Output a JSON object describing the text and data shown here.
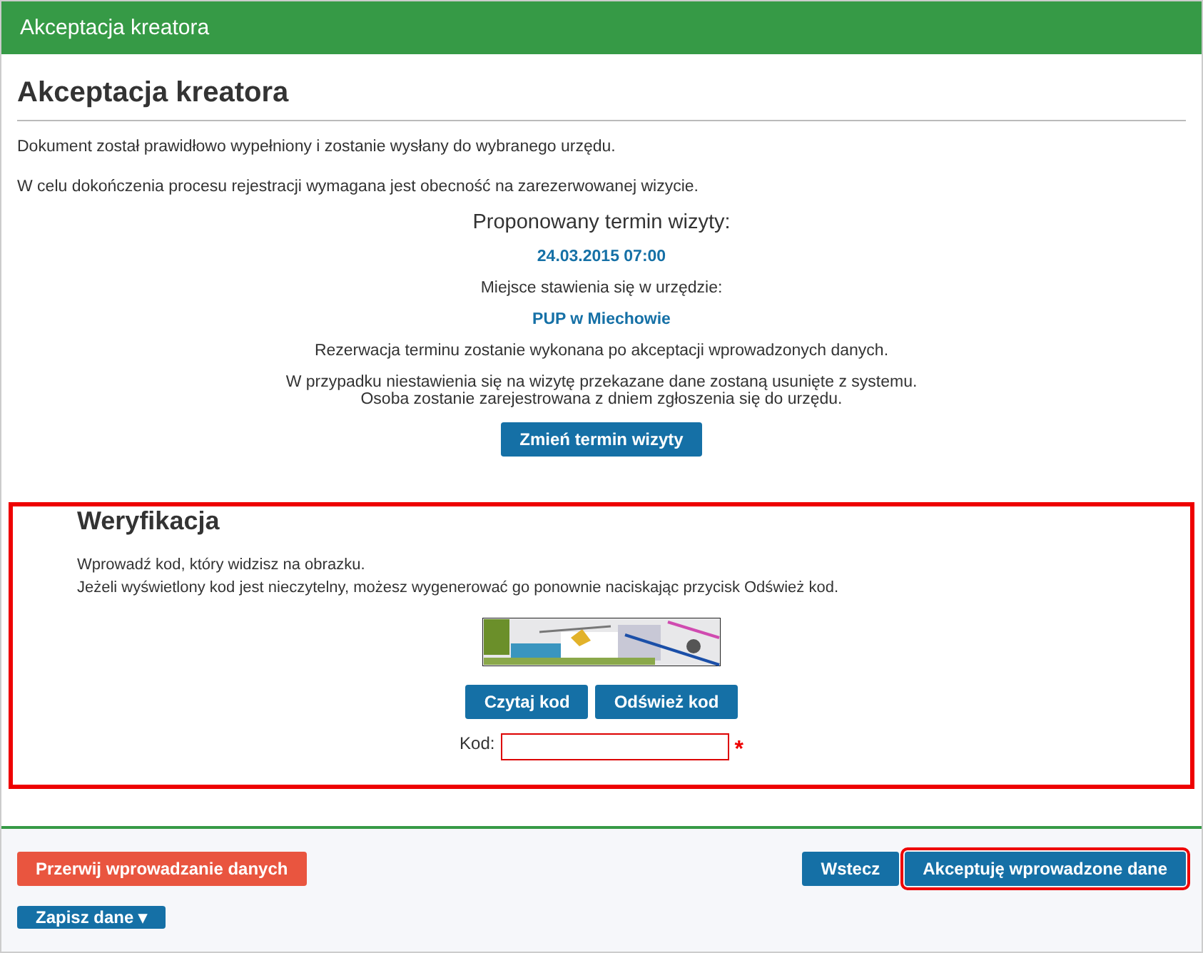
{
  "window": {
    "title": "Akceptacja kreatora"
  },
  "page": {
    "heading": "Akceptacja kreatora",
    "paragraphs": [
      "Dokument został prawidłowo wypełniony i zostanie wysłany do wybranego urzędu.",
      "W celu dokończenia procesu rejestracji wymagana jest obecność na zarezerwowanej wizycie."
    ]
  },
  "appointment": {
    "heading": "Proponowany termin wizyty:",
    "date": "24.03.2015 07:00",
    "place_label": "Miejsce stawienia się w urzędzie:",
    "place": "PUP w Miechowie",
    "note": "Rezerwacja terminu zostanie wykonana po akceptacji wprowadzonych danych.",
    "warning_lines": [
      "W przypadku niestawienia się na wizytę przekazane dane zostaną usunięte z systemu.",
      "Osoba zostanie zarejestrowana z dniem zgłoszenia się do urzędu."
    ],
    "button": "Zmień termin wizyty"
  },
  "verification": {
    "highlighted": true,
    "heading": "Weryfikacja",
    "instructions": [
      "Wprowadź kod, który widzisz na obrazku.",
      "Jeżeli wyświetlony kod jest nieczytelny, możesz wygenerować go ponownie naciskając przycisk Odśwież kod."
    ],
    "buttons": [
      "Czytaj kod",
      "Odśwież kod"
    ],
    "field_label": "Kod:",
    "required_mark": "*"
  },
  "footer": {
    "cancel": "Przerwij wprowadzanie danych",
    "back": "Wstecz",
    "accept": {
      "label": "Akceptuję wprowadzone dane",
      "highlighted": true
    },
    "save": {
      "label": "Zapisz dane",
      "caret": "▾"
    }
  }
}
